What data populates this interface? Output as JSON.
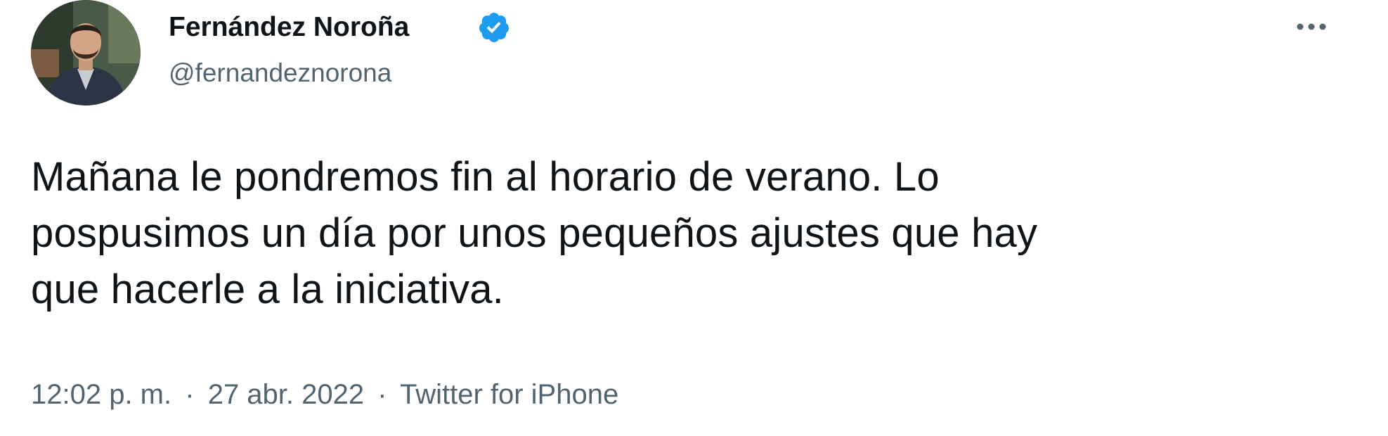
{
  "tweet": {
    "author": {
      "display_name": "Fernández Noroña",
      "handle": "@fernandeznorona",
      "verified": true,
      "avatar_icon": "profile-photo"
    },
    "menu_icon": "more-horizontal-icon",
    "text_lines": [
      "Mañana le pondremos fin al horario de verano. Lo",
      "pospusimos un día por unos pequeños ajustes que hay",
      "que hacerle a la iniciativa."
    ],
    "time": "12:02 p. m.",
    "separator": "·",
    "date": "27 abr. 2022",
    "source": "Twitter for iPhone"
  },
  "colors": {
    "text": "#0f1419",
    "secondary": "#536471",
    "verified_blue": "#1d9bf0",
    "background": "#ffffff"
  }
}
